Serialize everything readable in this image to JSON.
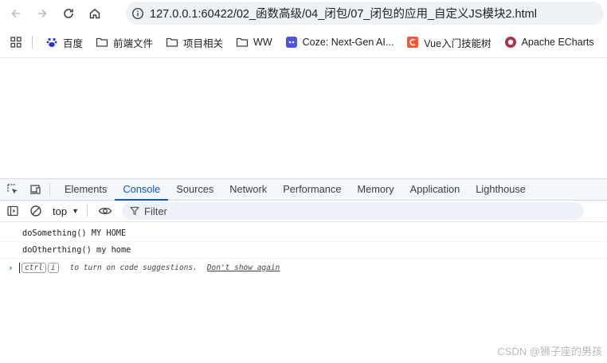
{
  "browser": {
    "url": "127.0.0.1:60422/02_函数高级/04_闭包/07_闭包的应用_自定义JS模块2.html"
  },
  "bookmarks": [
    {
      "label": "百度",
      "icon": "baidu-icon"
    },
    {
      "label": "前端文件",
      "icon": "folder-icon"
    },
    {
      "label": "项目相关",
      "icon": "folder-icon"
    },
    {
      "label": "WW",
      "icon": "folder-icon"
    },
    {
      "label": "Coze: Next-Gen AI...",
      "icon": "coze-icon"
    },
    {
      "label": "Vue入门技能树",
      "icon": "csdn-icon"
    },
    {
      "label": "Apache ECharts",
      "icon": "echarts-icon"
    }
  ],
  "devtools": {
    "tabs": [
      "Elements",
      "Console",
      "Sources",
      "Network",
      "Performance",
      "Memory",
      "Application",
      "Lighthouse"
    ],
    "active_tab": "Console",
    "context": "top",
    "filter_placeholder": "Filter",
    "logs": [
      "doSomething() MY HOME",
      "doOtherthing() my home"
    ],
    "prompt": {
      "key1": "ctrl",
      "key2": "i",
      "hint": "to turn on code suggestions.",
      "link": "Don't show again"
    }
  },
  "watermark": "CSDN @狮子座的男孩",
  "colors": {
    "accent": "#0b57d0",
    "tabs_bg": "#f3f6fb",
    "omnibox_bg": "#eef1f6"
  }
}
